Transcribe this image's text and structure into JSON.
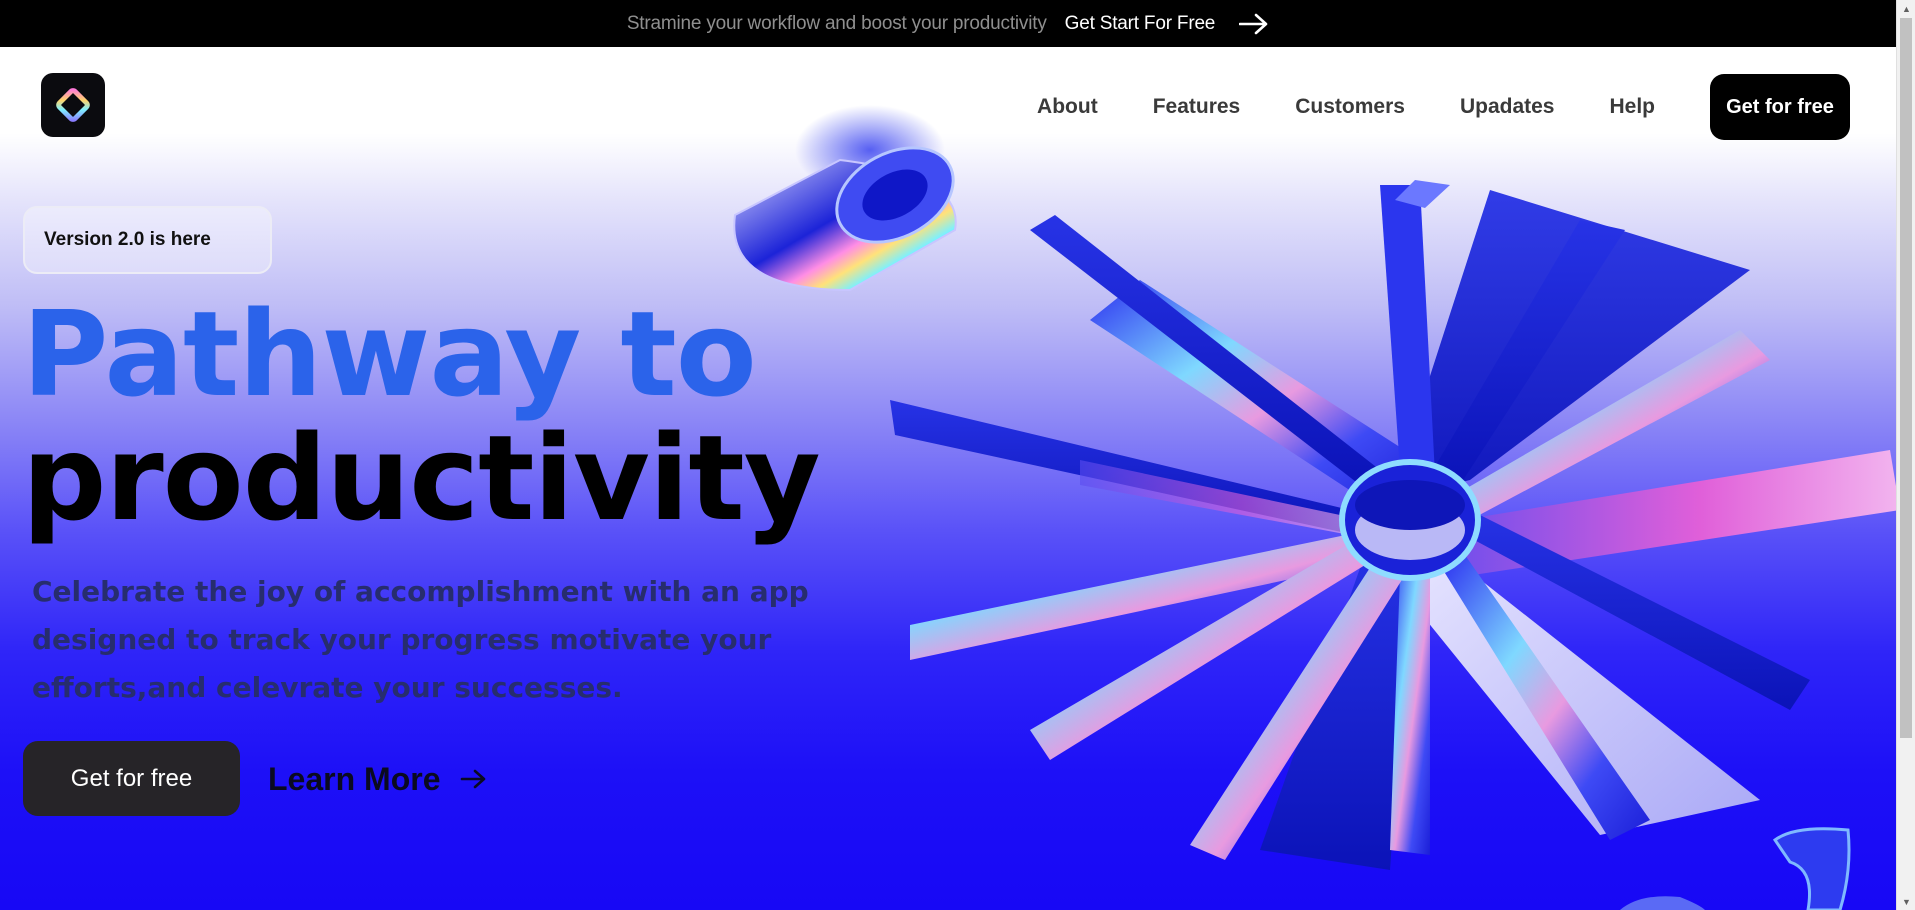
{
  "topbar": {
    "promo_text": "Stramine your workflow and boost your productivity",
    "cta_label": "Get Start For Free",
    "cta_icon": "arrow-right-icon"
  },
  "nav": {
    "logo_icon": "diamond-logo-icon",
    "links": [
      "About",
      "Features",
      "Customers",
      "Upadates",
      "Help"
    ],
    "cta_label": "Get for free"
  },
  "hero": {
    "badge": "Version 2.0 is here",
    "headline_line1": "Pathway to",
    "headline_line2": "productivity",
    "subtitle": "Celebrate the joy of accomplishment with an app designed to track your progress motivate your efforts,and celevrate your successes.",
    "primary_button": "Get for free",
    "secondary_button": "Learn More",
    "secondary_icon": "arrow-right-icon"
  },
  "colors": {
    "accent_blue": "#2b63ea",
    "hero_bottom": "#1708f5",
    "button_dark": "#262428",
    "topbar_bg": "#000000"
  }
}
